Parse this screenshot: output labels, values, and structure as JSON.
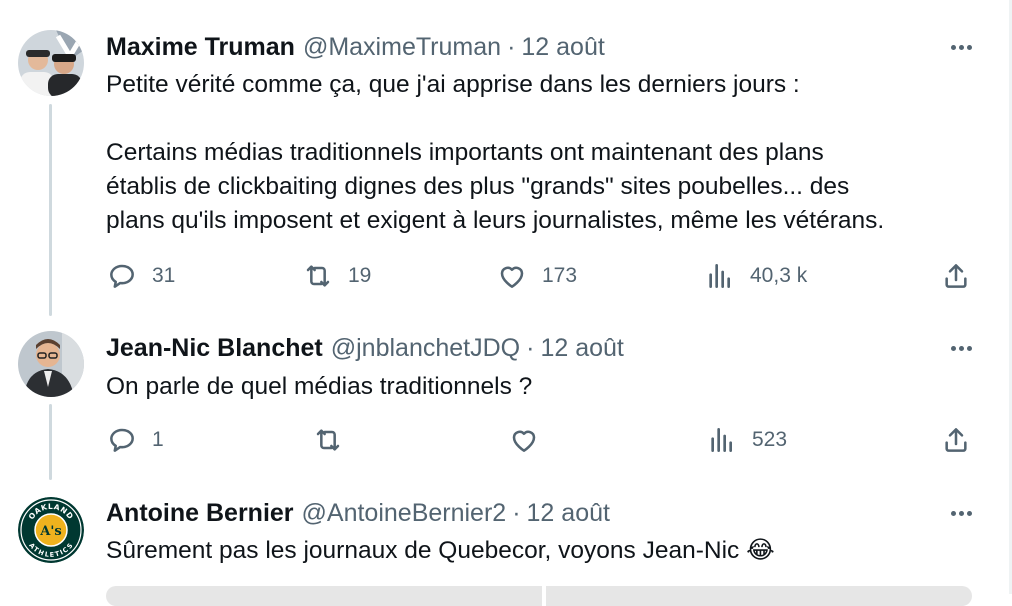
{
  "tweets": [
    {
      "name": "Maxime Truman",
      "handle": "@MaximeTruman",
      "date": "12 août",
      "text_lines": [
        "Petite vérité comme ça, que j'ai apprise dans les derniers jours :",
        "",
        "Certains médias traditionnels importants ont maintenant des plans",
        "établis de clickbaiting dignes des plus \"grands\" sites poubelles... des",
        "plans qu'ils imposent et exigent à leurs journalistes, même les vétérans."
      ],
      "replies": "31",
      "retweets": "19",
      "likes": "173",
      "views": "40,3 k"
    },
    {
      "name": "Jean-Nic Blanchet",
      "handle": "@jnblanchetJDQ",
      "date": "12 août",
      "text_lines": [
        "On parle de quel médias traditionnels ?"
      ],
      "replies": "1",
      "retweets": "",
      "likes": "",
      "views": "523"
    },
    {
      "name": "Antoine Bernier",
      "handle": "@AntoineBernier2",
      "date": "12 août",
      "text_lines": [
        "Sûrement pas les journaux de Quebecor, voyons Jean-Nic 😂"
      ]
    }
  ],
  "separator": "·",
  "avatar_logo_text": {
    "top": "OAKLAND",
    "bottom": "ATHLETICS",
    "center": "A's"
  },
  "colors": {
    "text": "#0f1419",
    "secondary": "#536471",
    "thread_line": "#cfd9de",
    "athletics_green": "#003831",
    "athletics_gold": "#efb21e"
  },
  "icons": [
    "reply-icon",
    "retweet-icon",
    "like-icon",
    "views-icon",
    "share-icon",
    "more-icon"
  ]
}
